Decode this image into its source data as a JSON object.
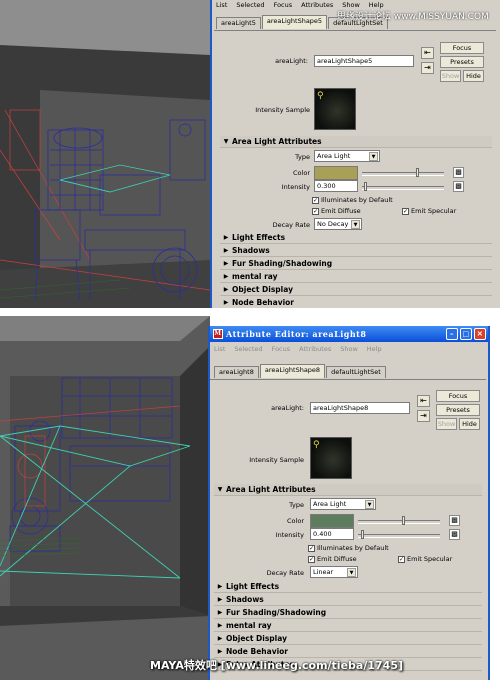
{
  "top": {
    "menu": [
      "List",
      "Selected",
      "Focus",
      "Attributes",
      "Show",
      "Help"
    ],
    "tabs": [
      "areaLight5",
      "areaLightShape5",
      "defaultLightSet"
    ],
    "active_tab": "areaLightShape5",
    "node_label": "areaLight:",
    "node_value": "areaLightShape5",
    "buttons": {
      "focus": "Focus",
      "presets": "Presets",
      "show": "Show",
      "hide": "Hide"
    },
    "sample_label": "Intensity Sample",
    "section_title": "Area Light Attributes",
    "type_label": "Type",
    "type_value": "Area Light",
    "color_label": "Color",
    "color_hex": "#a8a057",
    "intensity_label": "Intensity",
    "intensity_value": "0.300",
    "illuminates": "Illuminates by Default",
    "emit_diffuse": "Emit Diffuse",
    "emit_specular": "Emit Specular",
    "decay_label": "Decay Rate",
    "decay_value": "No Decay",
    "sections": [
      "Light Effects",
      "Shadows",
      "Fur Shading/Shadowing",
      "mental ray",
      "Object Display",
      "Node Behavior"
    ]
  },
  "bottom": {
    "window_title": "Attribute Editor: areaLight8",
    "menu": [
      "List",
      "Selected",
      "Focus",
      "Attributes",
      "Show",
      "Help"
    ],
    "tabs": [
      "areaLight8",
      "areaLightShape8",
      "defaultLightSet"
    ],
    "active_tab": "areaLightShape8",
    "node_label": "areaLight:",
    "node_value": "areaLightShape8",
    "buttons": {
      "focus": "Focus",
      "presets": "Presets",
      "show": "Show",
      "hide": "Hide"
    },
    "sample_label": "Intensity Sample",
    "section_title": "Area Light Attributes",
    "type_label": "Type",
    "type_value": "Area Light",
    "color_label": "Color",
    "color_hex": "#5e7d5e",
    "intensity_label": "Intensity",
    "intensity_value": "0.400",
    "illuminates": "Illuminates by Default",
    "emit_diffuse": "Emit Diffuse",
    "emit_specular": "Emit Specular",
    "decay_label": "Decay Rate",
    "decay_value": "Linear",
    "sections": [
      "Light Effects",
      "Shadows",
      "Fur Shading/Shadowing",
      "mental ray",
      "Object Display",
      "Node Behavior",
      "Extra Attributes"
    ]
  },
  "watermark_top": "思缘设计论坛 www.MISSYUAN.COM",
  "watermark_bottom": "MAYA特效吧 [www.lineeg.com/tieba/1745]",
  "accent": "#1b58c8"
}
